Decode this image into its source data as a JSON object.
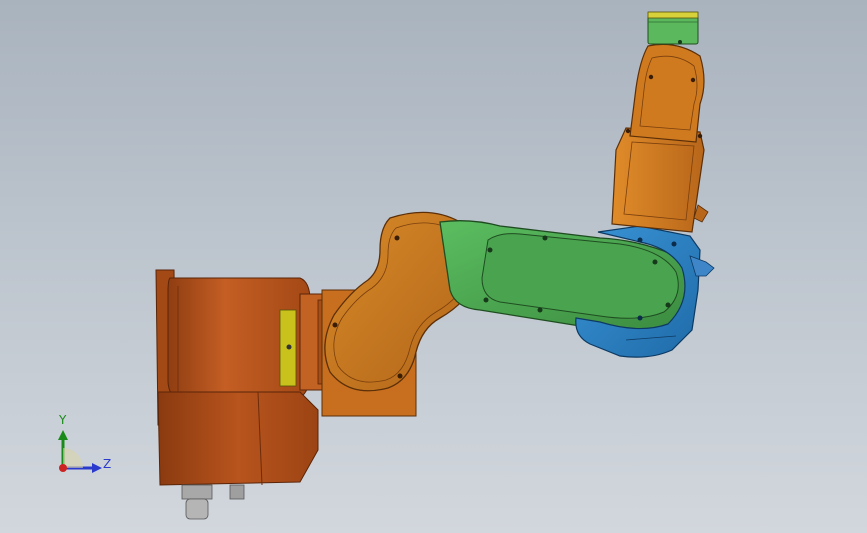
{
  "viewport": {
    "background_top": "#a9b3be",
    "background_bottom": "#d2d7dd"
  },
  "model": {
    "base_color": "#b4521d",
    "shoulder_color": "#c8751e",
    "upper_arm_color": "#45a04a",
    "forearm_color": "#2d7fc0",
    "wrist_color": "#cf7b1e",
    "flange_color": "#5cb85c",
    "flange_ring_color": "#d7d23a",
    "label_plate_color": "#c9c11c",
    "parts": [
      "robot-base",
      "shoulder-link",
      "upper-arm-link",
      "forearm-link",
      "wrist-link",
      "tool-flange"
    ]
  },
  "triad": {
    "y_label": "Y",
    "z_label": "Z",
    "y_color": "#1a8a1a",
    "z_color": "#2a3acc",
    "x_color": "#cc2222"
  }
}
